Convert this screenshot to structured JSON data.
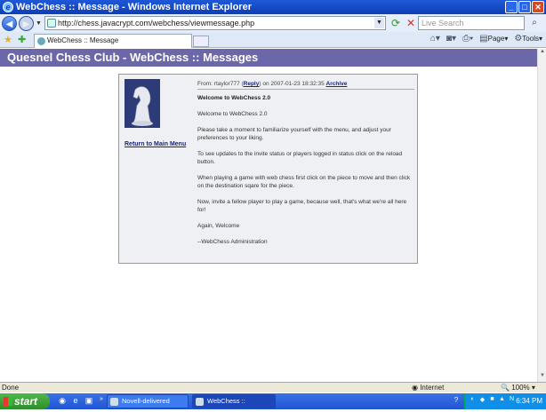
{
  "window": {
    "title": "WebChess :: Message - Windows Internet Explorer",
    "icon": "ie-icon"
  },
  "address": {
    "url": "http://chess.javacrypt.com/webchess/viewmessage.php",
    "search_placeholder": "Live Search"
  },
  "tab": {
    "label": "WebChess :: Message"
  },
  "toolbar": {
    "page_label": "Page",
    "tools_label": "Tools"
  },
  "page": {
    "header": "Quesnel Chess Club - WebChess :: Messages",
    "return_link": "Return to Main Menu"
  },
  "message": {
    "from_prefix": "From: rtaylor777 (",
    "reply_label": "Reply",
    "from_suffix": ") on 2007-01-23 18:32:35",
    "archive_label": "Archive",
    "subject": "Welcome to WebChess 2.0",
    "paragraphs": [
      "Welcome to WebChess 2.0",
      "Please take a moment to familiarize yourself with the menu, and adjust your preferences to your liking.",
      "To see updates to the invite status or players logged in status click on the reload button.",
      "When playing a game with web chess first click on the piece to move and then click on the destination sqare for the piece.",
      "Now, invite a fellow player to play a game, because well, that's what we're all here for!",
      "Again, Welcome",
      "--WebChess Administration"
    ]
  },
  "status": {
    "left": "Done",
    "zone": "Internet",
    "zoom": "100%"
  },
  "taskbar": {
    "start_label": "start",
    "tasks": [
      {
        "label": "Novell-delivered Appli..."
      },
      {
        "label": "WebChess :: Messag..."
      }
    ],
    "clock": "6:34 PM"
  }
}
